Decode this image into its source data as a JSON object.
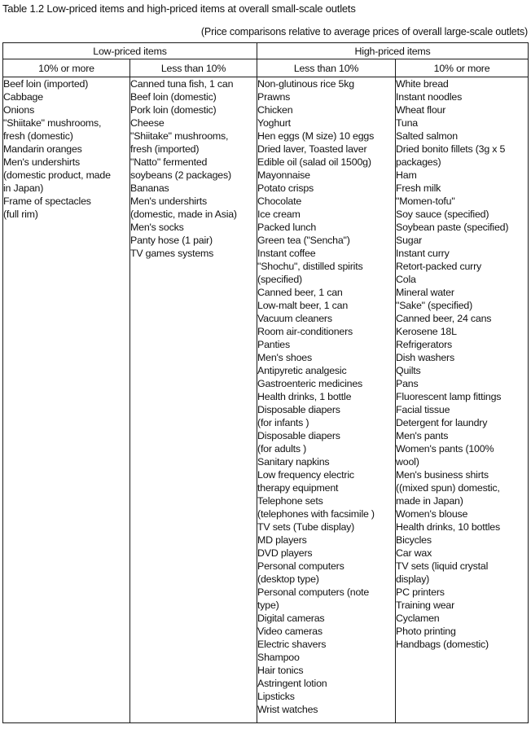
{
  "title": "Table 1.2 Low-priced items and high-priced items at overall small-scale outlets",
  "note": "(Price comparisons relative to average prices of overall large-scale outlets)",
  "groups": [
    {
      "label": "Low-priced items"
    },
    {
      "label": "High-priced items"
    }
  ],
  "columns": [
    {
      "header": "10% or more",
      "group": "Low-priced items",
      "lines": [
        "Beef loin (imported)",
        "Cabbage",
        "Onions",
        "\"Shiitake\" mushrooms,",
        "fresh (domestic)",
        "Mandarin oranges",
        "Men's undershirts",
        "(domestic product, made",
        "in Japan)",
        "Frame of spectacles",
        "(full rim)"
      ]
    },
    {
      "header": "Less than 10%",
      "group": "Low-priced items",
      "lines": [
        "Canned tuna fish, 1 can",
        "Beef loin (domestic)",
        "Pork loin (domestic)",
        "Cheese",
        "\"Shiitake\" mushrooms,",
        "fresh (imported)",
        "\"Natto\" fermented",
        "soybeans (2 packages)",
        "Bananas",
        "Men's undershirts",
        "(domestic, made in Asia)",
        "Men's socks",
        "Panty hose (1 pair)",
        "TV games systems"
      ]
    },
    {
      "header": "Less than 10%",
      "group": "High-priced items",
      "lines": [
        "Non-glutinous rice 5kg",
        "Prawns",
        "Chicken",
        "Yoghurt",
        "Hen eggs (M size) 10 eggs",
        "Dried laver, Toasted laver",
        "Edible oil (salad oil 1500g)",
        "Mayonnaise",
        "Potato crisps",
        "Chocolate",
        "Ice cream",
        "Packed lunch",
        "Green tea (\"Sencha\")",
        "Instant coffee",
        "\"Shochu\", distilled spirits",
        "(specified)",
        "Canned beer, 1 can",
        "Low-malt beer, 1 can",
        "Vacuum cleaners",
        "Room air-conditioners",
        "Panties",
        "Men's shoes",
        "Antipyretic analgesic",
        "Gastroenteric medicines",
        "Health drinks, 1 bottle",
        "Disposable diapers",
        "(for infants )",
        "Disposable diapers",
        "(for adults )",
        "Sanitary napkins",
        "Low frequency electric",
        "therapy equipment",
        "Telephone sets",
        "(telephones with facsimile )",
        "TV sets (Tube display)",
        "MD players",
        "DVD players",
        "Personal computers",
        "(desktop type)",
        "Personal computers (note",
        "type)",
        "Digital cameras",
        "Video cameras",
        "Electric shavers",
        "Shampoo",
        "Hair tonics",
        "Astringent lotion",
        "Lipsticks",
        "Wrist watches"
      ]
    },
    {
      "header": "10% or more",
      "group": "High-priced items",
      "lines": [
        "White bread",
        "Instant noodles",
        "Wheat flour",
        "Tuna",
        "Salted salmon",
        "Dried bonito fillets (3g x 5",
        "packages)",
        "Ham",
        "Fresh milk",
        "\"Momen-tofu\"",
        "Soy sauce (specified)",
        "Soybean paste (specified)",
        "Sugar",
        "Instant curry",
        "Retort-packed curry",
        "Cola",
        "Mineral water",
        "\"Sake\" (specified)",
        "Canned beer, 24 cans",
        "Kerosene 18L",
        "Refrigerators",
        "Dish washers",
        "Quilts",
        "Pans",
        "Fluorescent lamp fittings",
        "Facial tissue",
        "Detergent for laundry",
        "Men's pants",
        "Women's pants (100%",
        "wool)",
        "Men's business shirts",
        "((mixed spun) domestic,",
        "made in Japan)",
        "Women's blouse",
        "Health drinks, 10 bottles",
        "Bicycles",
        "Car wax",
        "TV sets (liquid crystal",
        "display)",
        "PC printers",
        "Training wear",
        "Cyclamen",
        "Photo printing",
        "Handbags (domestic)"
      ]
    }
  ]
}
